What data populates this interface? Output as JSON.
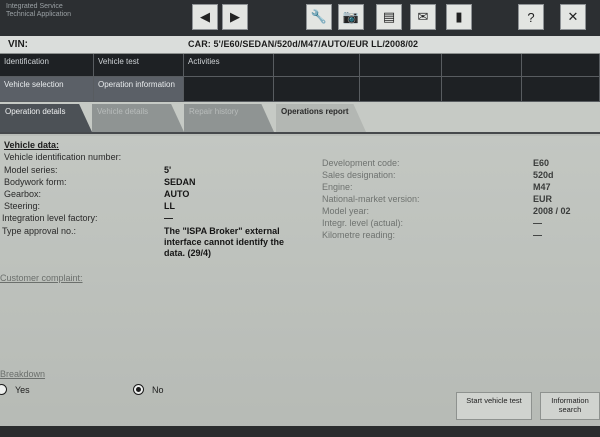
{
  "app": {
    "title_line1": "Integrated Service",
    "title_line2": "Technical Application"
  },
  "toolbar": {
    "icons": [
      "back-arrow-icon",
      "forward-arrow-icon",
      "wrench-icon",
      "camera-icon",
      "print-icon",
      "email-icon",
      "battery-icon",
      "help-icon",
      "close-icon"
    ]
  },
  "header": {
    "vin_label": "VIN:",
    "car_label": "CAR:  5'/E60/SEDAN/520d/M47/AUTO/EUR LL/2008/02"
  },
  "menu": {
    "top": [
      "Identification",
      "Vehicle test",
      "Activities"
    ],
    "second": [
      "Vehicle selection",
      "Operation information"
    ]
  },
  "tabs": [
    "Operation details",
    "Vehicle details",
    "Repair history",
    "Operations report"
  ],
  "vehicle": {
    "heading": "Vehicle data:",
    "left": [
      {
        "label": "Vehicle identification number:",
        "value": ""
      },
      {
        "label": "Model series:",
        "value": "5'"
      },
      {
        "label": "Bodywork form:",
        "value": "SEDAN"
      },
      {
        "label": "Gearbox:",
        "value": "AUTO"
      },
      {
        "label": "Steering:",
        "value": "LL"
      },
      {
        "label": "Integration level factory:",
        "value": "—"
      },
      {
        "label": "Type approval no.:",
        "value": "The \"ISPA Broker\" external interface cannot identify the data. (29/4)"
      }
    ],
    "right": [
      {
        "label": "Development code:",
        "value": "E60"
      },
      {
        "label": "Sales designation:",
        "value": "520d"
      },
      {
        "label": "Engine:",
        "value": "M47"
      },
      {
        "label": "National-market version:",
        "value": "EUR"
      },
      {
        "label": "Model year:",
        "value": "2008 / 02"
      },
      {
        "label": "Integr. level (actual):",
        "value": "—"
      },
      {
        "label": "Kilometre reading:",
        "value": "—"
      }
    ]
  },
  "complaint_label": "Customer complaint:",
  "breakdown": {
    "label": "Breakdown",
    "options": [
      "Yes",
      "No"
    ],
    "selected": "No"
  },
  "buttons": {
    "start_test": "Start vehicle test",
    "info_search": "Information search"
  }
}
